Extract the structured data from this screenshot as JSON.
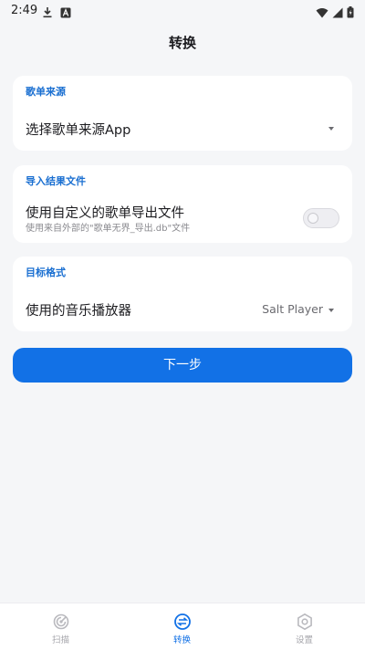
{
  "status_bar": {
    "time": "2:49",
    "icons_left": [
      "download-icon",
      "a-box-icon"
    ],
    "icons_right": [
      "wifi-icon",
      "signal-icon",
      "battery-icon"
    ]
  },
  "header": {
    "title": "转换"
  },
  "source_card": {
    "label": "歌单来源",
    "select_text": "选择歌单来源App"
  },
  "import_card": {
    "label": "导入结果文件",
    "option_title": "使用自定义的歌单导出文件",
    "option_subtitle": "使用来自外部的\"歌单无界_导出.db\"文件",
    "toggle_on": false
  },
  "target_card": {
    "label": "目标格式",
    "row_label": "使用的音乐播放器",
    "selected_player": "Salt Player"
  },
  "next_button": {
    "label": "下一步"
  },
  "bottom_nav": {
    "items": [
      {
        "label": "扫描",
        "icon": "scan-icon",
        "active": false
      },
      {
        "label": "转换",
        "icon": "convert-icon",
        "active": true
      },
      {
        "label": "设置",
        "icon": "settings-icon",
        "active": false
      }
    ]
  },
  "colors": {
    "accent": "#1271e6",
    "label_blue": "#1a6fd1",
    "background": "#f5f6f8"
  }
}
